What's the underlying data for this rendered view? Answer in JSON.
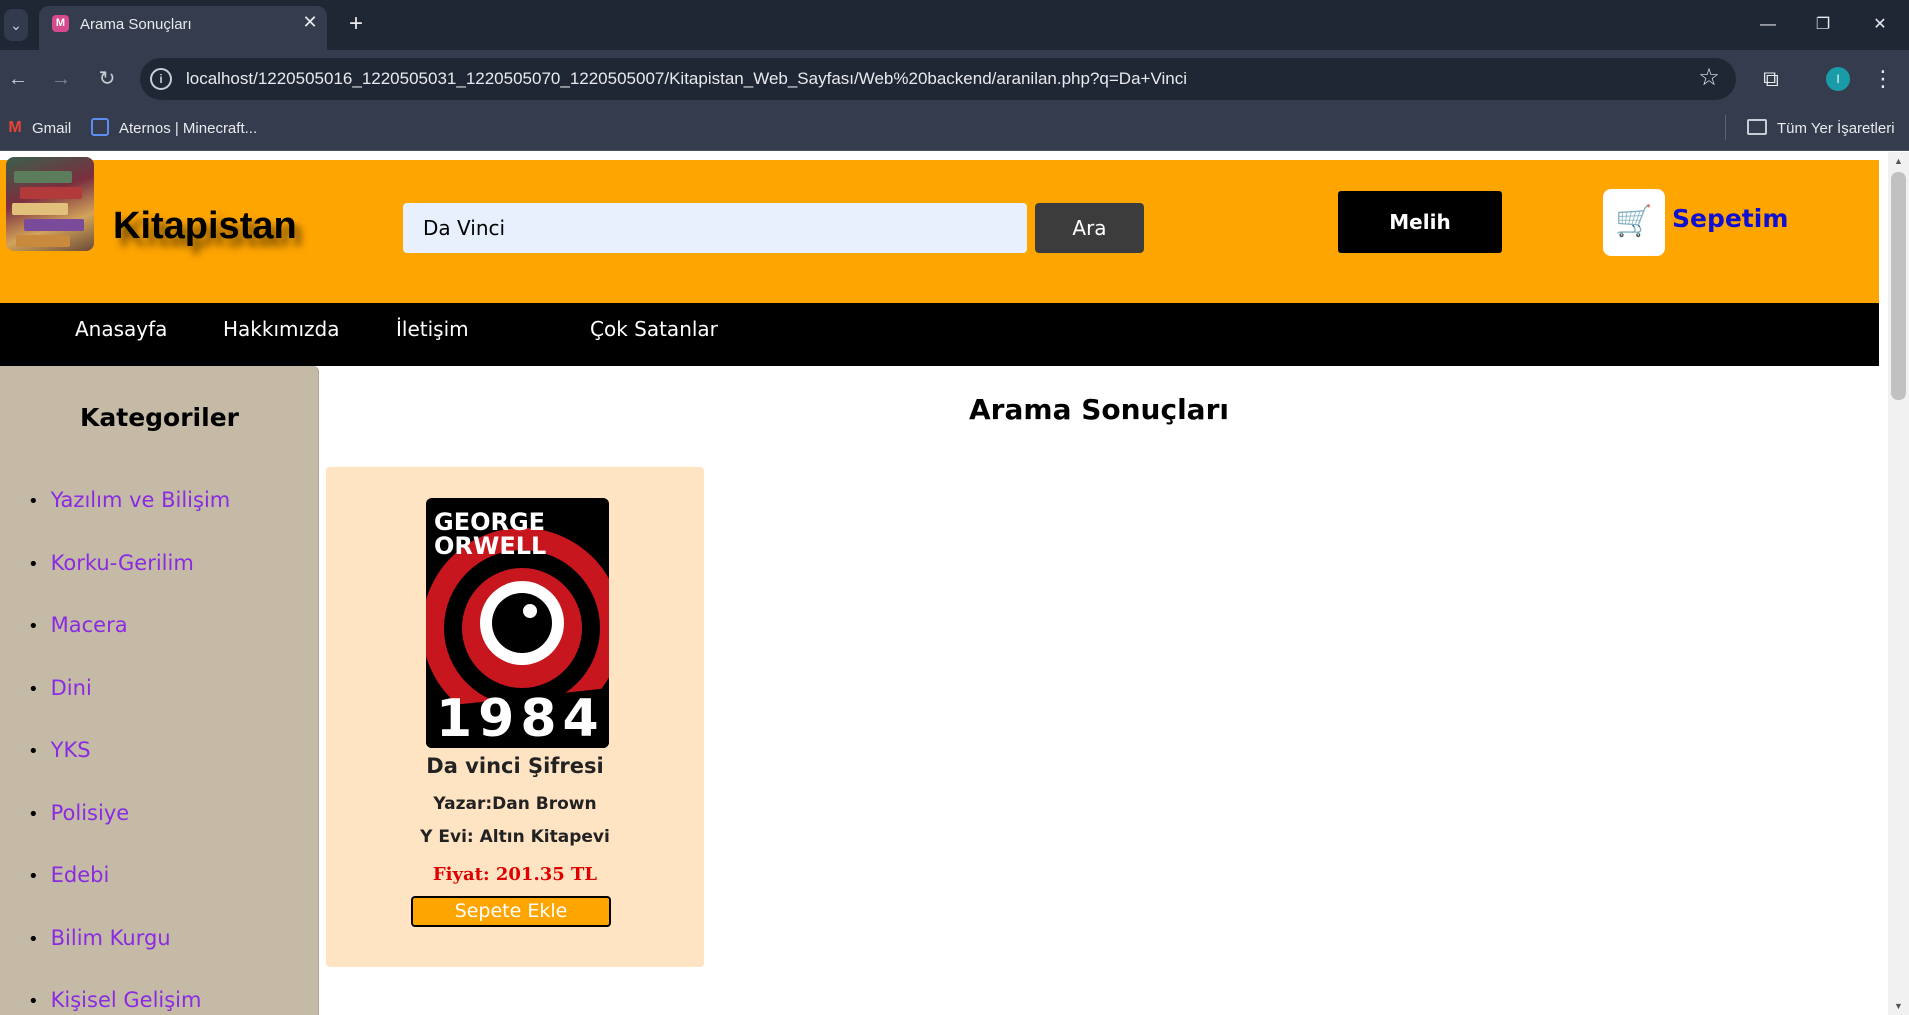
{
  "browser": {
    "tab_title": "Arama Sonuçları",
    "tab_close": "✕",
    "new_tab": "+",
    "url": "localhost/1220505016_1220505031_1220505070_1220505007/Kitapistan_Web_Sayfası/Web%20backend/aranilan.php?q=Da+Vinci",
    "profile_initial": "I",
    "bookmarks": [
      {
        "label": "Gmail",
        "icon": "gmail-icon"
      },
      {
        "label": "Aternos | Minecraft...",
        "icon": "aternos-icon"
      }
    ],
    "all_bookmarks": "Tüm Yer İşaretleri"
  },
  "header": {
    "brand": "Kitapistan",
    "search_value": "Da Vinci",
    "search_button": "Ara",
    "user_name": "Melih",
    "cart_label": "Sepetim",
    "background_color": "#ffa500"
  },
  "nav": {
    "items": [
      "Anasayfa",
      "Hakkımızda",
      "İletişim",
      "Çok Satanlar"
    ]
  },
  "sidebar": {
    "title": "Kategoriler",
    "categories": [
      "Yazılım ve Bilişim",
      "Korku-Gerilim",
      "Macera",
      "Dini",
      "YKS",
      "Polisiye",
      "Edebi",
      "Bilim Kurgu",
      "Kişisel Gelişim"
    ]
  },
  "results": {
    "title": "Arama Sonuçları",
    "products": [
      {
        "title": "Da vinci Şifresi",
        "author": "Yazar:Dan Brown",
        "publisher": "Y Evi: Altın Kitapevi",
        "price": "Fiyat: 201.35 TL",
        "button": "Sepete Ekle",
        "cover_text": {
          "line1": "GEORGE",
          "line2": "ORWELL",
          "number": "1984"
        }
      }
    ]
  }
}
